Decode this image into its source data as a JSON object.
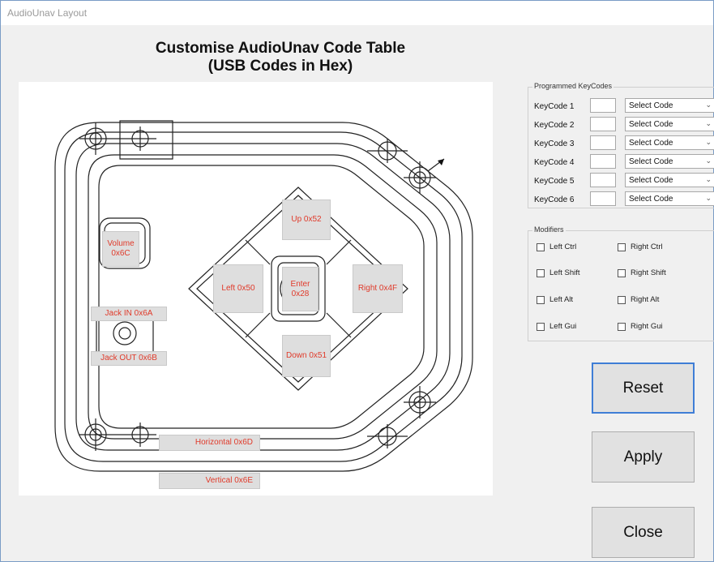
{
  "window": {
    "title": "AudioUnav Layout"
  },
  "heading": {
    "line1": "Customise AudioUnav Code Table",
    "line2": "(USB Codes in Hex)"
  },
  "diagram": {
    "labels": {
      "up": "Up 0x52",
      "left": "Left 0x50",
      "enter": "Enter 0x28",
      "right": "Right 0x4F",
      "down": "Down 0x51",
      "volume": "Volume 0x6C",
      "jack_in": "Jack IN 0x6A",
      "jack_out": "Jack OUT 0x6B",
      "horizontal": "Horizontal 0x6D",
      "vertical": "Vertical 0x6E"
    }
  },
  "keycodes": {
    "title": "Programmed KeyCodes",
    "rows": [
      {
        "label": "KeyCode 1",
        "value": "",
        "select": "Select Code"
      },
      {
        "label": "KeyCode 2",
        "value": "",
        "select": "Select Code"
      },
      {
        "label": "KeyCode 3",
        "value": "",
        "select": "Select Code"
      },
      {
        "label": "KeyCode 4",
        "value": "",
        "select": "Select Code"
      },
      {
        "label": "KeyCode 5",
        "value": "",
        "select": "Select Code"
      },
      {
        "label": "KeyCode 6",
        "value": "",
        "select": "Select Code"
      }
    ]
  },
  "modifiers": {
    "title": "Modifiers",
    "left_ctrl": "Left Ctrl",
    "right_ctrl": "Right Ctrl",
    "left_shift": "Left Shift",
    "right_shift": "Right Shift",
    "left_alt": "Left Alt",
    "right_alt": "Right Alt",
    "left_gui": "Left Gui",
    "right_gui": "Right Gui"
  },
  "buttons": {
    "reset": "Reset",
    "apply": "Apply",
    "close": "Close"
  },
  "colors": {
    "label_text": "#e03a2a",
    "label_bg": "#dedede",
    "focus_border": "#3f7ed6"
  }
}
